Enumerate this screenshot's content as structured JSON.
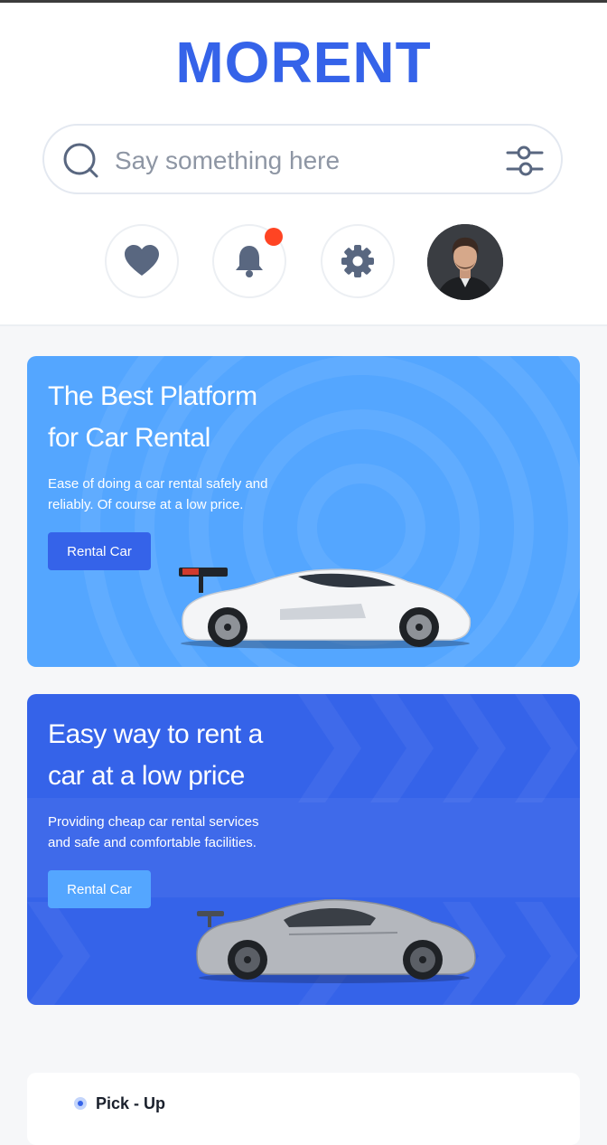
{
  "app": {
    "title": "MORENT"
  },
  "search": {
    "placeholder": "Say something here",
    "value": ""
  },
  "header_icons": {
    "favorites": "heart-icon",
    "notifications": "bell-icon",
    "notification_badge": true,
    "settings": "gear-icon",
    "profile": "avatar"
  },
  "colors": {
    "primary": "#3563e9",
    "secondary": "#54a6ff",
    "badge": "#ff4423",
    "background": "#f6f7f9"
  },
  "ads": [
    {
      "title_line1": "The Best Platform",
      "title_line2": "for Car Rental",
      "description_line1": "Ease of doing a car rental safely and",
      "description_line2": "reliably. Of course at a low price.",
      "button": "Rental Car"
    },
    {
      "title_line1": "Easy way to rent a",
      "title_line2": "car at a low price",
      "description_line1": "Providing cheap car rental services",
      "description_line2": "and safe and comfortable facilities.",
      "button": "Rental Car"
    }
  ],
  "pickup": {
    "label": "Pick - Up"
  }
}
